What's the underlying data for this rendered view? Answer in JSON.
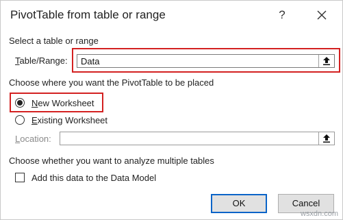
{
  "dialog": {
    "title": "PivotTable from table or range",
    "help_symbol": "?",
    "close_icon": "close-icon"
  },
  "section_source": {
    "heading": "Select a table or range",
    "range_label_underlined": "T",
    "range_label_rest": "able/Range:",
    "range_value": "Data"
  },
  "section_placement": {
    "heading": "Choose where you want the PivotTable to be placed",
    "new_worksheet_underlined": "N",
    "new_worksheet_rest": "ew Worksheet",
    "new_worksheet_selected": true,
    "existing_worksheet_underlined": "E",
    "existing_worksheet_rest": "xisting Worksheet",
    "existing_worksheet_selected": false,
    "location_underlined": "L",
    "location_rest": "ocation:",
    "location_value": ""
  },
  "section_multiple": {
    "heading": "Choose whether you want to analyze multiple tables",
    "data_model_label": "Add this data to the Data Model",
    "data_model_checked": false
  },
  "buttons": {
    "ok": "OK",
    "cancel": "Cancel"
  },
  "watermark": "wsxdn.com",
  "colors": {
    "highlight": "#d32020",
    "ok_border": "#0a64c8",
    "button_face": "#e1e1e1"
  }
}
